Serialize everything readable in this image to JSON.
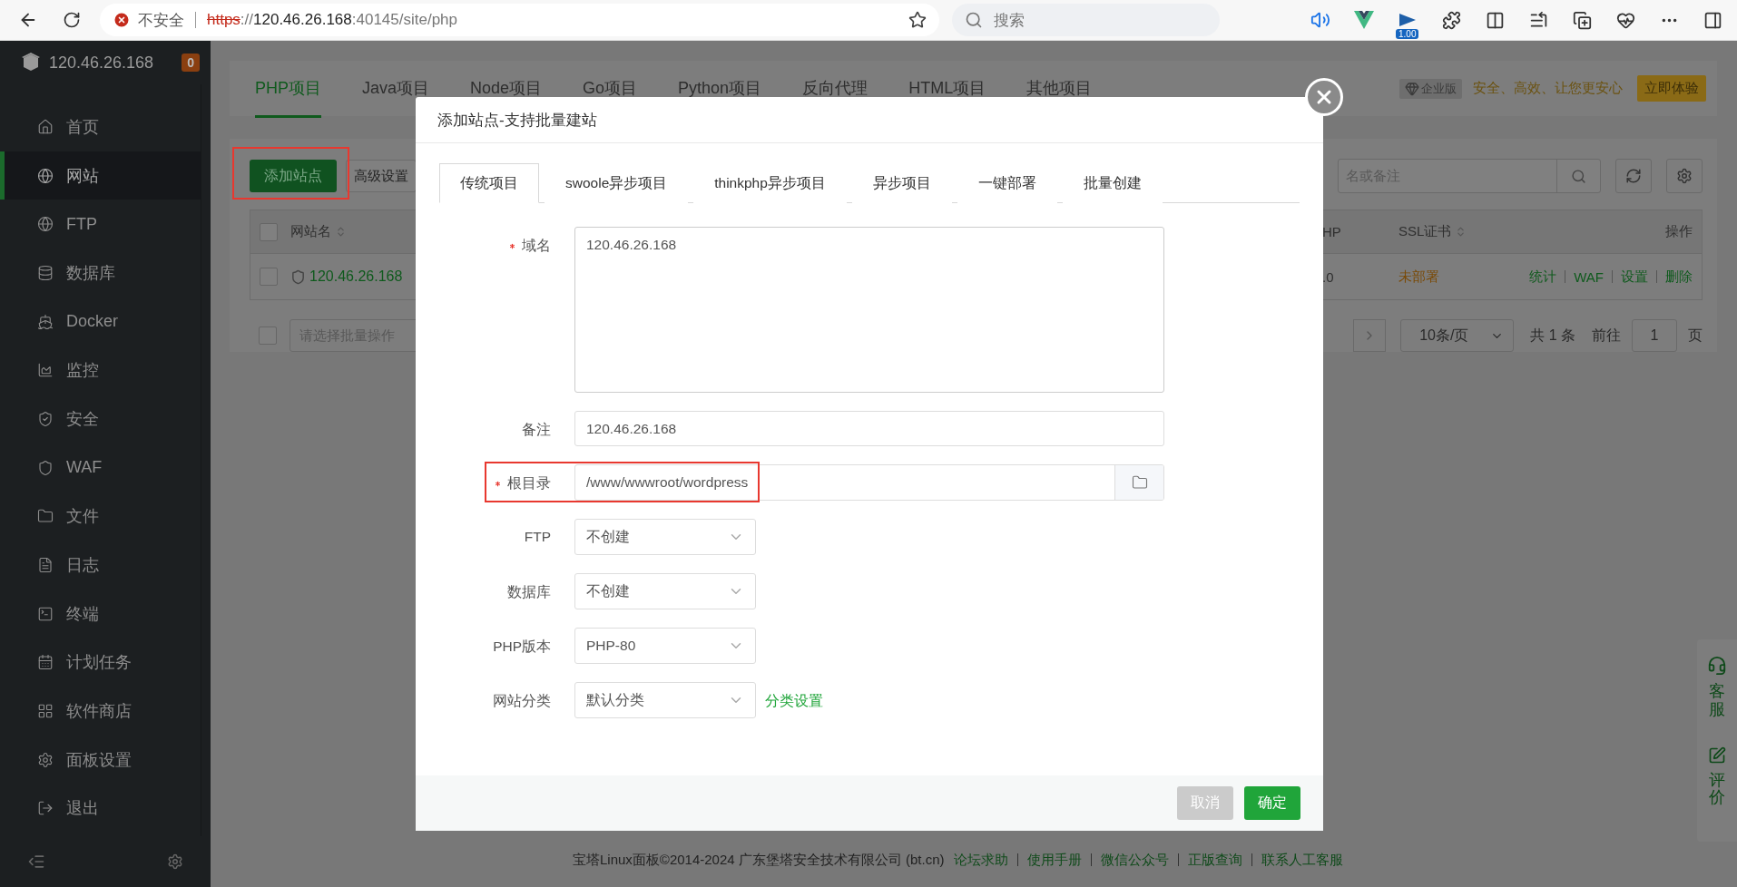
{
  "browser": {
    "security_label": "不安全",
    "url": [
      {
        "text": "https",
        "kind": "scheme"
      },
      {
        "text": "://",
        "kind": "path"
      },
      {
        "text": "120.46.26.168",
        "kind": "host"
      },
      {
        "text": ":40145/site/php",
        "kind": "path"
      }
    ],
    "search_placeholder": "搜索",
    "extension_badge": "1.00"
  },
  "sidebar": {
    "host": "120.46.26.168",
    "badge": "0",
    "items": [
      {
        "label": "首页",
        "selected": false
      },
      {
        "label": "网站",
        "selected": true
      },
      {
        "label": "FTP",
        "selected": false
      },
      {
        "label": "数据库",
        "selected": false
      },
      {
        "label": "Docker",
        "selected": false
      },
      {
        "label": "监控",
        "selected": false
      },
      {
        "label": "安全",
        "selected": false
      },
      {
        "label": "WAF",
        "selected": false
      },
      {
        "label": "文件",
        "selected": false
      },
      {
        "label": "日志",
        "selected": false
      },
      {
        "label": "终端",
        "selected": false
      },
      {
        "label": "计划任务",
        "selected": false
      },
      {
        "label": "软件商店",
        "selected": false
      },
      {
        "label": "面板设置",
        "selected": false
      },
      {
        "label": "退出",
        "selected": false
      }
    ]
  },
  "project_tabs": [
    {
      "label": "PHP项目",
      "selected": true
    },
    {
      "label": "Java项目",
      "selected": false
    },
    {
      "label": "Node项目",
      "selected": false
    },
    {
      "label": "Go项目",
      "selected": false
    },
    {
      "label": "Python项目",
      "selected": false
    },
    {
      "label": "反向代理",
      "selected": false
    },
    {
      "label": "HTML项目",
      "selected": false
    },
    {
      "label": "其他项目",
      "selected": false
    }
  ],
  "promo": {
    "edition": "企业版",
    "slogan": "安全、高效、让您更安心",
    "button": "立即体验"
  },
  "toolbar": {
    "add_button": {
      "label": "添加站点",
      "annotated": true
    },
    "advanced_button": "高级设置",
    "search_placeholder": "名或备注"
  },
  "table": {
    "header_checked": false,
    "columns": [
      {
        "label": "网站名",
        "sortable": true
      },
      {
        "label": "HP",
        "sortable": false
      },
      {
        "label": "SSL证书",
        "sortable": true
      },
      {
        "label": "操作",
        "sortable": false
      }
    ],
    "rows": [
      {
        "checked": false,
        "name": "120.46.26.168",
        "php": ".0",
        "ssl": "未部署",
        "actions": [
          "统计",
          "WAF",
          "设置",
          "删除"
        ]
      }
    ]
  },
  "batch": {
    "checked": false,
    "placeholder": "请选择批量操作"
  },
  "pagination": {
    "page_size": "10条/页",
    "total": "共 1 条",
    "goto_label": "前往",
    "page": "1",
    "page_suffix": "页"
  },
  "dialog": {
    "title": "添加站点-支持批量建站",
    "tabs": [
      {
        "label": "传统项目",
        "selected": true
      },
      {
        "label": "swoole异步项目",
        "selected": false
      },
      {
        "label": "thinkphp异步项目",
        "selected": false
      },
      {
        "label": "异步项目",
        "selected": false
      },
      {
        "label": "一键部署",
        "selected": false
      },
      {
        "label": "批量创建",
        "selected": false
      }
    ],
    "fields": [
      {
        "kind": "textarea",
        "label": "域名",
        "required": true,
        "annotated": false,
        "value": "120.46.26.168"
      },
      {
        "kind": "input",
        "label": "备注",
        "required": false,
        "annotated": false,
        "value": "120.46.26.168"
      },
      {
        "kind": "path",
        "label": "根目录",
        "required": true,
        "annotated": true,
        "value": "/www/wwwroot/wordpress"
      },
      {
        "kind": "select",
        "label": "FTP",
        "required": false,
        "annotated": false,
        "value": "不创建"
      },
      {
        "kind": "select",
        "label": "数据库",
        "required": false,
        "annotated": false,
        "value": "不创建"
      },
      {
        "kind": "select",
        "label": "PHP版本",
        "required": false,
        "annotated": false,
        "value": "PHP-80"
      },
      {
        "kind": "select",
        "label": "网站分类",
        "required": false,
        "annotated": false,
        "value": "默认分类",
        "link": "分类设置"
      }
    ],
    "buttons": [
      {
        "kind": "cancel",
        "label": "取消"
      },
      {
        "kind": "confirm",
        "label": "确定"
      }
    ]
  },
  "footer": {
    "copyright": "宝塔Linux面板©2014-2024 广东堡塔安全技术有限公司 (bt.cn)",
    "links": [
      "论坛求助",
      "使用手册",
      "微信公众号",
      "正版查询",
      "联系人工客服"
    ]
  },
  "float_panel": [
    "客服",
    "评价"
  ]
}
